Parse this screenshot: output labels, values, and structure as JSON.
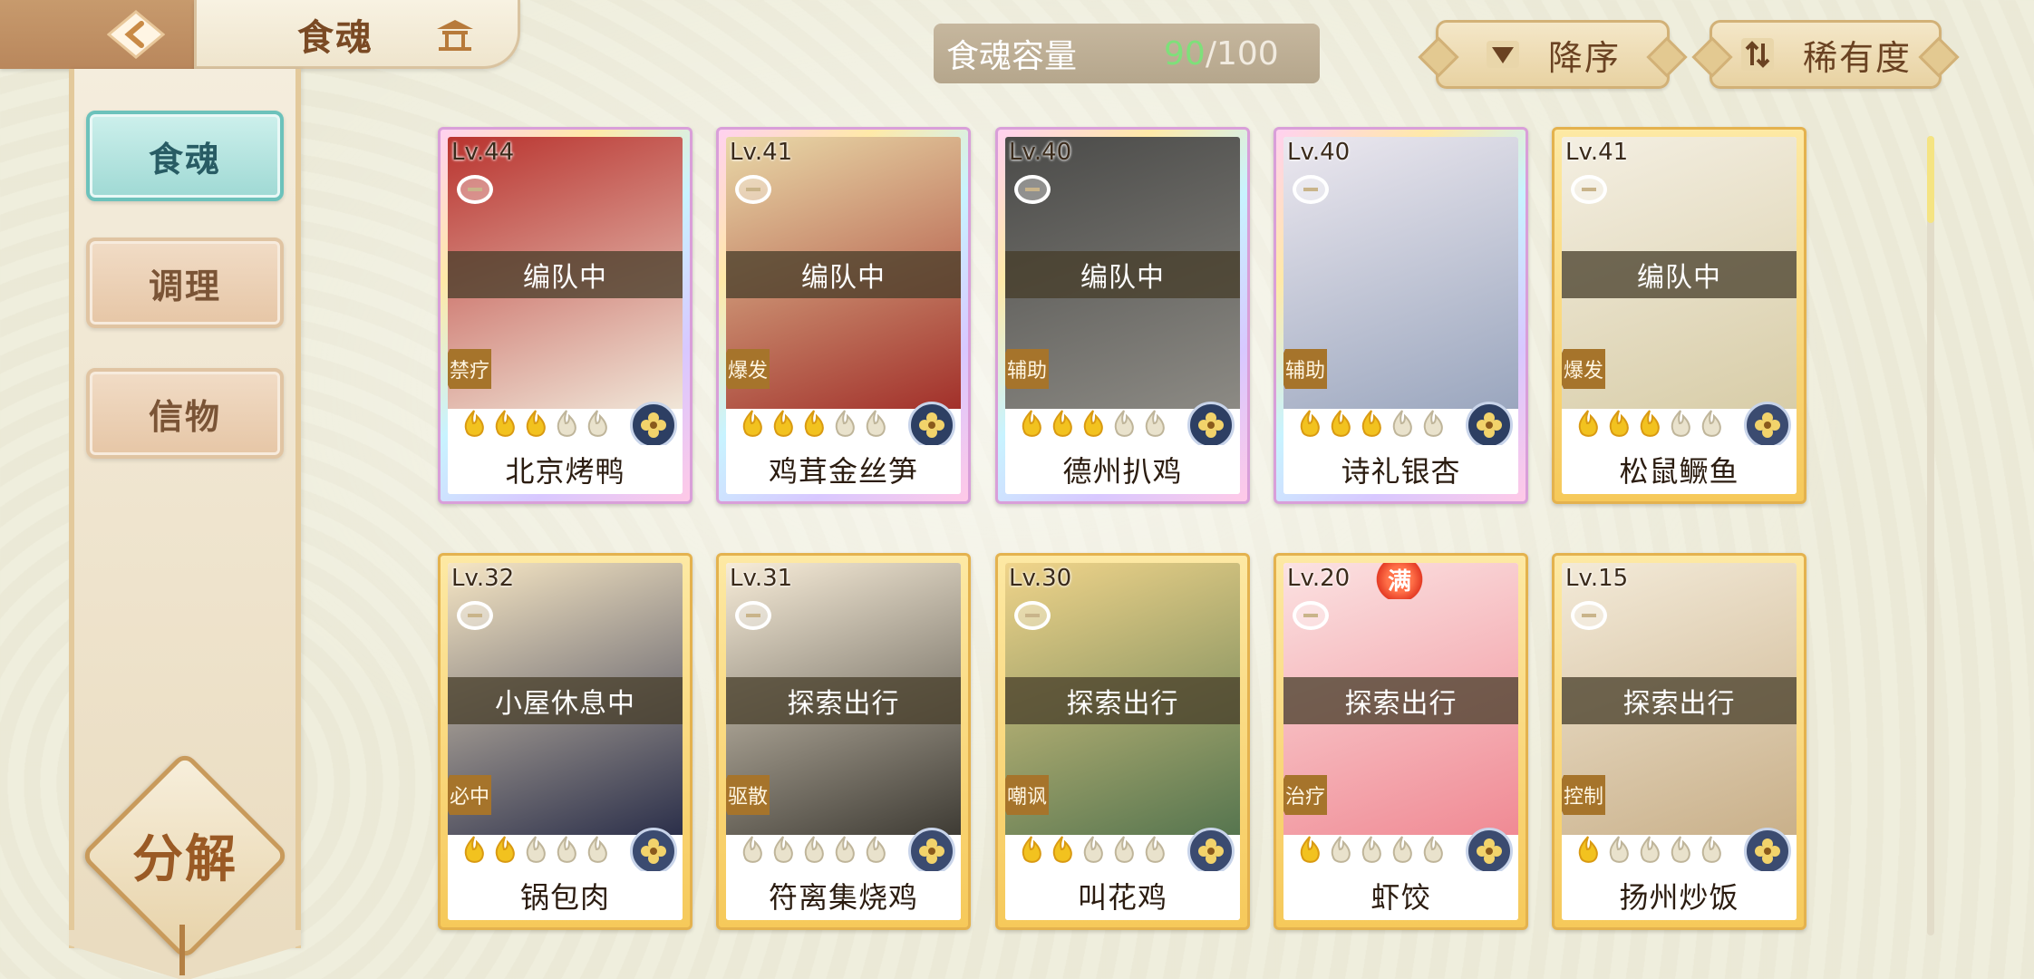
{
  "header": {
    "title": "食魂",
    "capacity_label": "食魂容量",
    "capacity_current": "90",
    "capacity_sep": "/",
    "capacity_max": "100",
    "sort_order_label": "降序",
    "sort_key_label": "稀有度",
    "back_icon": "back-arrow-icon",
    "home_icon": "pavilion-home-icon"
  },
  "sidebar": {
    "tabs": [
      {
        "label": "食魂",
        "active": true
      },
      {
        "label": "调理",
        "active": false
      },
      {
        "label": "信物",
        "active": false
      }
    ],
    "decompose_label": "分解"
  },
  "cards": [
    {
      "level": "Lv.44",
      "status": "编队中",
      "role": "禁疗",
      "name": "北京烤鸭",
      "stars": 3,
      "frame": "rainbow"
    },
    {
      "level": "Lv.41",
      "status": "编队中",
      "role": "爆发",
      "name": "鸡茸金丝笋",
      "stars": 3,
      "frame": "rainbow"
    },
    {
      "level": "Lv.40",
      "status": "编队中",
      "role": "辅助",
      "name": "德州扒鸡",
      "stars": 3,
      "frame": "rainbow"
    },
    {
      "level": "Lv.40",
      "status": "",
      "role": "辅助",
      "name": "诗礼银杏",
      "stars": 3,
      "frame": "rainbow"
    },
    {
      "level": "Lv.41",
      "status": "编队中",
      "role": "爆发",
      "name": "松鼠鳜鱼",
      "stars": 3,
      "frame": "gold"
    },
    {
      "level": "Lv.32",
      "status": "小屋休息中",
      "role": "必中",
      "name": "锅包肉",
      "stars": 2,
      "frame": "gold"
    },
    {
      "level": "Lv.31",
      "status": "探索出行",
      "role": "驱散",
      "name": "符离集烧鸡",
      "stars": 0,
      "frame": "gold"
    },
    {
      "level": "Lv.30",
      "status": "探索出行",
      "role": "嘲讽",
      "name": "叫花鸡",
      "stars": 2,
      "frame": "gold"
    },
    {
      "level": "Lv.20",
      "status": "探索出行",
      "role": "治疗",
      "name": "虾饺",
      "stars": 1,
      "frame": "gold",
      "badge": "满"
    },
    {
      "level": "Lv.15",
      "status": "探索出行",
      "role": "控制",
      "name": "扬州炒饭",
      "stars": 1,
      "frame": "gold"
    }
  ],
  "colors": {
    "background": "#efeedd",
    "active_tab": "#9fd9d4",
    "capacity_current": "#7ee07a",
    "flame_lit": "#f2c21f",
    "flame_unlit": "#e9e2cc"
  }
}
